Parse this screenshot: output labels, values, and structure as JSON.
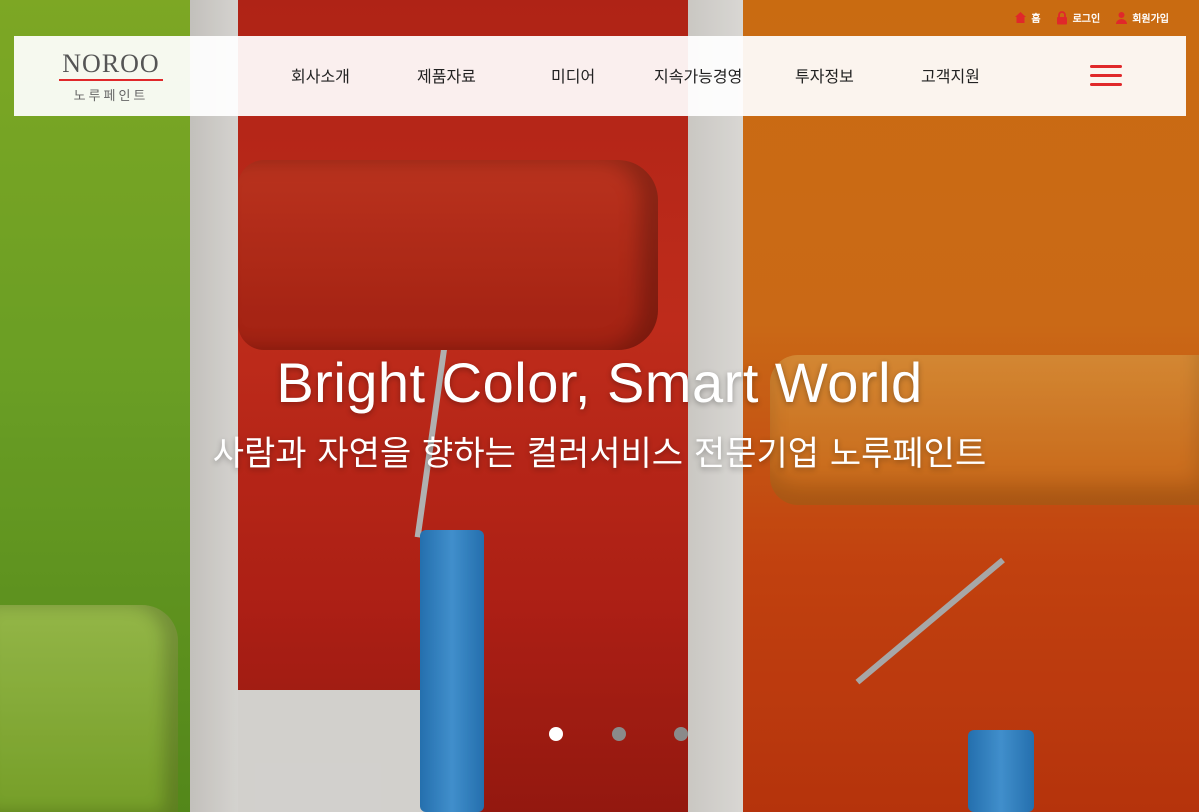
{
  "header": {
    "logo": {
      "en": "NOROO",
      "ko": "노루페인트"
    },
    "utility_links": [
      {
        "label": "홈",
        "icon": "home-icon"
      },
      {
        "label": "로그인",
        "icon": "lock-icon"
      },
      {
        "label": "회원가입",
        "icon": "user-icon"
      }
    ],
    "menu": [
      "회사소개",
      "제품자료",
      "미디어",
      "지속가능경영",
      "투자정보",
      "고객지원"
    ],
    "menu_icon": "hamburger-menu-icon"
  },
  "hero": {
    "headline": "Bright Color, Smart World",
    "subline": "사람과 자연을 향하는 컬러서비스 전문기업 노루페인트",
    "slides": {
      "count": 3,
      "active": 1
    }
  },
  "colors": {
    "brand_red": "#e0282a",
    "dot_active": "#ffffff",
    "dot_inactive": "#8a8a8a"
  }
}
